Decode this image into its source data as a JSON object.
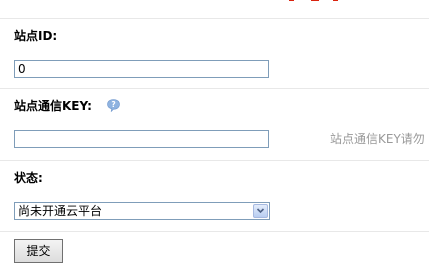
{
  "form": {
    "site_id": {
      "label": "站点ID:",
      "value": "0"
    },
    "site_key": {
      "label": "站点通信KEY:",
      "value": "",
      "hint": "站点通信KEY请勿"
    },
    "status": {
      "label": "状态:",
      "selected": "尚未开通云平台"
    },
    "submit_label": "提交"
  },
  "icons": {
    "help": "help-bubble-icon",
    "dropdown": "chevron-down-icon"
  },
  "colors": {
    "accent_red": "#d9230f",
    "help_icon": "#8fb3e0",
    "hint_text": "#999999"
  }
}
